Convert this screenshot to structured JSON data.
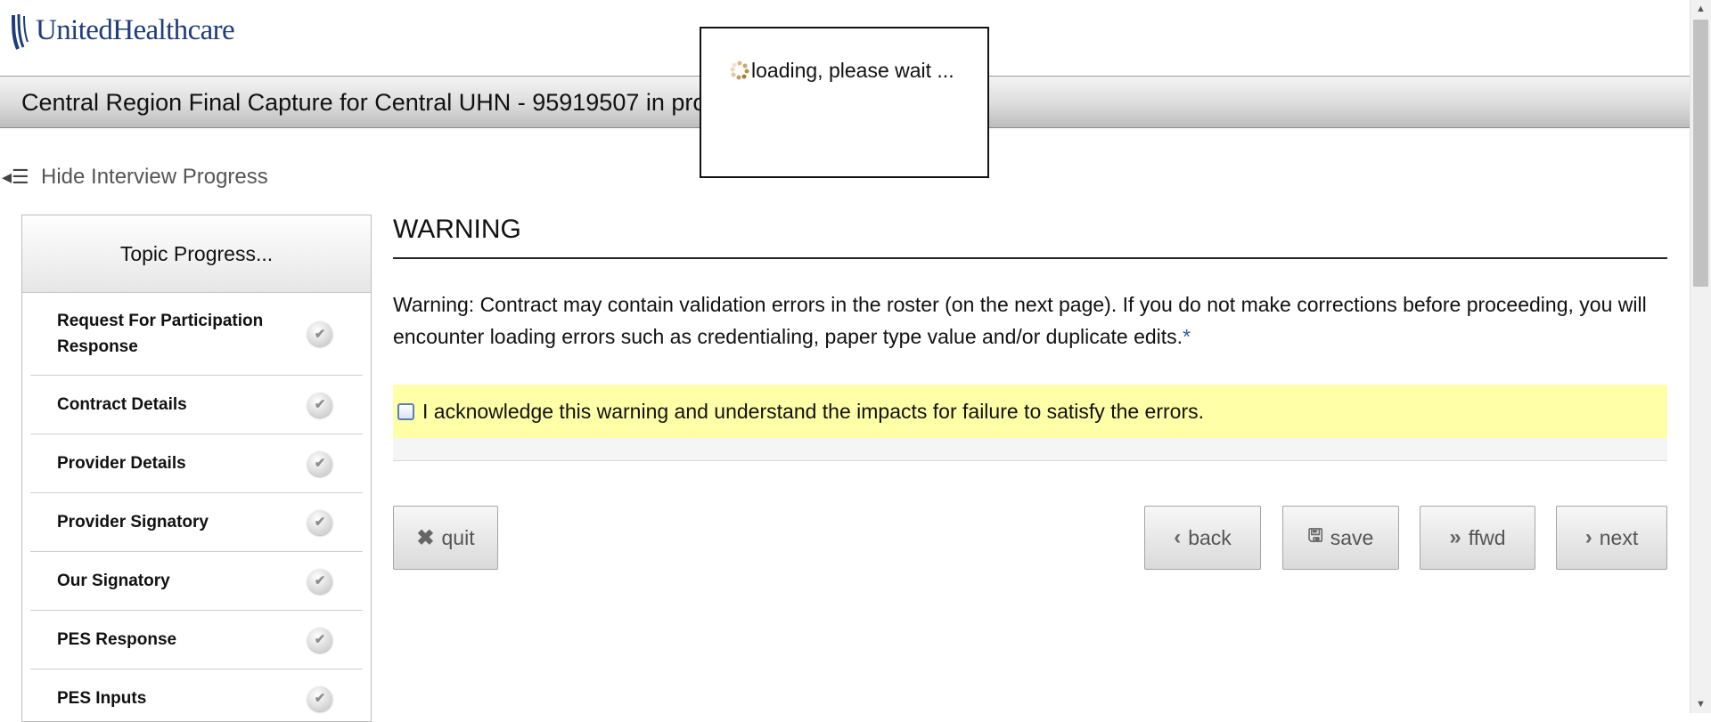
{
  "brand": {
    "logo_text": "UnitedHealthcare",
    "logo_color": "#1f3d7a"
  },
  "title_bar": {
    "text": "Central Region Final Capture for Central UHN - 95919507 in pro"
  },
  "progress_toggle": {
    "label": "Hide Interview Progress",
    "icon": "collapse-list-icon"
  },
  "sidebar": {
    "heading": "Topic Progress...",
    "items": [
      {
        "label": "Request For Participation Response",
        "status_icon": "check-icon"
      },
      {
        "label": "Contract Details",
        "status_icon": "check-icon"
      },
      {
        "label": "Provider Details",
        "status_icon": "check-icon"
      },
      {
        "label": "Provider Signatory",
        "status_icon": "check-icon"
      },
      {
        "label": "Our Signatory",
        "status_icon": "check-icon"
      },
      {
        "label": "PES Response",
        "status_icon": "check-icon"
      },
      {
        "label": "PES Inputs",
        "status_icon": "check-icon"
      }
    ]
  },
  "main": {
    "heading": "WARNING",
    "warning_text": "Warning: Contract may contain validation errors in the roster (on the next page). If you do not make corrections before proceeding, you will encounter loading errors such as credentialing, paper type value and/or duplicate edits.",
    "required_marker": "*",
    "acknowledge_label": "I acknowledge this warning and understand the impacts for failure to satisfy the errors.",
    "acknowledge_checked": false,
    "highlight_color": "#ffffa8"
  },
  "buttons": {
    "quit": {
      "label": "quit",
      "icon": "x-icon"
    },
    "back": {
      "label": "back",
      "icon": "chevron-left-icon"
    },
    "save": {
      "label": "save",
      "icon": "floppy-disk-icon"
    },
    "ffwd": {
      "label": "ffwd",
      "icon": "double-chevron-right-icon"
    },
    "next": {
      "label": "next",
      "icon": "chevron-right-icon"
    }
  },
  "loading_dialog": {
    "message": "loading, please wait ...",
    "icon": "spinner-icon"
  }
}
